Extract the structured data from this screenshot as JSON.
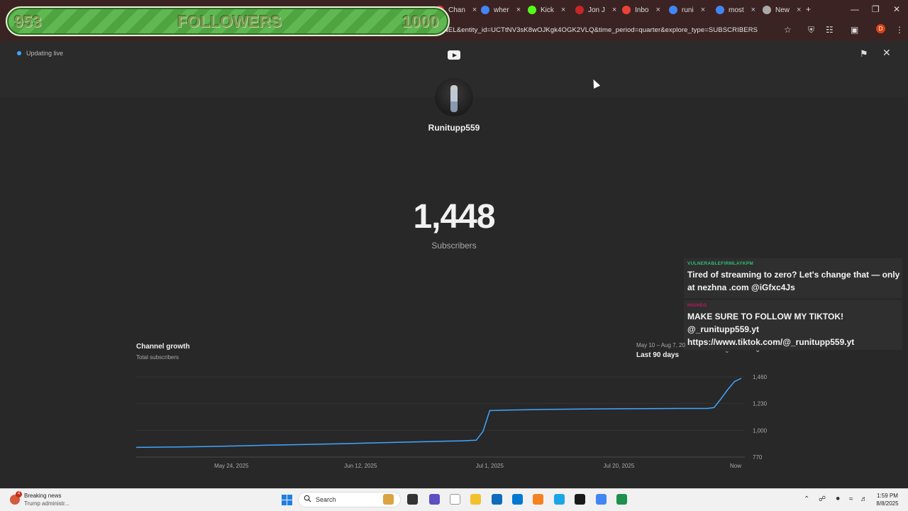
{
  "browser": {
    "tabs": [
      {
        "label": "Chan",
        "color": "#e53935"
      },
      {
        "label": "wher",
        "color": "#4285f4"
      },
      {
        "label": "Kick",
        "color": "#53fc18"
      },
      {
        "label": "Jon J",
        "color": "#c62828"
      },
      {
        "label": "Inbo",
        "color": "#ea4335"
      },
      {
        "label": "runi",
        "color": "#4285f4"
      },
      {
        "label": "most",
        "color": "#4285f4"
      },
      {
        "label": "New",
        "color": "#aaaaaa"
      }
    ],
    "close_glyph": "×",
    "new_tab_glyph": "+",
    "url": "=CHANNEL&entity_id=UCTtNV3sK8wOJKgk4OGK2VLQ&time_period=quarter&explore_type=SUBSCRIBERS",
    "profile_initial": "D"
  },
  "followers_overlay": {
    "current": "953",
    "label": "FOLLOWERS",
    "goal": "1000"
  },
  "studio": {
    "live_status": "Updating live",
    "channel_name": "Runitupp559",
    "subscriber_count": "1,448",
    "subscriber_label": "Subscribers",
    "chart_title": "Channel growth",
    "chart_subtitle": "Total subscribers",
    "range_dates": "May 10 – Aug 7, 20",
    "range_label": "Last 90 days"
  },
  "chat": [
    {
      "user": "VULNERABLEFIRMLAYKPM",
      "user_color": "#2fbf71",
      "message": "Tired of streaming to zero? Let's change that — only at nezhna .com @iGfxc4Js"
    },
    {
      "user": "HIGHEG",
      "user_color": "#c2185b",
      "message": "MAKE SURE TO FOLLOW MY TIKTOK! @_runitupp559.yt https://www.tiktok.com/@_runitupp559.yt"
    }
  ],
  "chart_data": {
    "type": "line",
    "title": "Channel growth",
    "subtitle": "Total subscribers",
    "x_tick_labels": [
      "May 24, 2025",
      "Jun 12, 2025",
      "Jul 1, 2025",
      "Jul 20, 2025",
      "Now"
    ],
    "x_tick_days": [
      14,
      33,
      52,
      71,
      89
    ],
    "y_tick_labels": [
      "1,460",
      "1,230",
      "1,000",
      "770"
    ],
    "y_ticks": [
      1460,
      1230,
      1000,
      770
    ],
    "ylim": [
      770,
      1460
    ],
    "xlim": [
      0,
      89
    ],
    "color": "#3ea6ff",
    "series": [
      {
        "x": [
          0,
          5,
          10,
          15,
          20,
          25,
          30,
          35,
          40,
          45,
          48,
          50,
          51,
          52,
          55,
          60,
          65,
          70,
          75,
          80,
          84,
          85,
          86,
          87,
          88,
          89
        ],
        "y": [
          853,
          856,
          860,
          866,
          873,
          878,
          884,
          892,
          899,
          906,
          910,
          915,
          990,
          1170,
          1175,
          1180,
          1183,
          1185,
          1187,
          1188,
          1188,
          1196,
          1270,
          1350,
          1420,
          1448
        ]
      }
    ]
  },
  "taskbar": {
    "news_badge": "4",
    "news_title": "Breaking news",
    "news_subtitle": "Trump administr...",
    "search_label": "Search",
    "time": "1:59 PM",
    "date": "8/8/2025",
    "icon_colors": [
      "#d9a441",
      "#333333",
      "#5b4fc2",
      "#ffffff",
      "#f2c12e",
      "#0f6cbd",
      "#0078d4",
      "#f58220",
      "#1aa6e6",
      "#1a1a1a",
      "#4285f4",
      "#1f8f4e"
    ]
  }
}
